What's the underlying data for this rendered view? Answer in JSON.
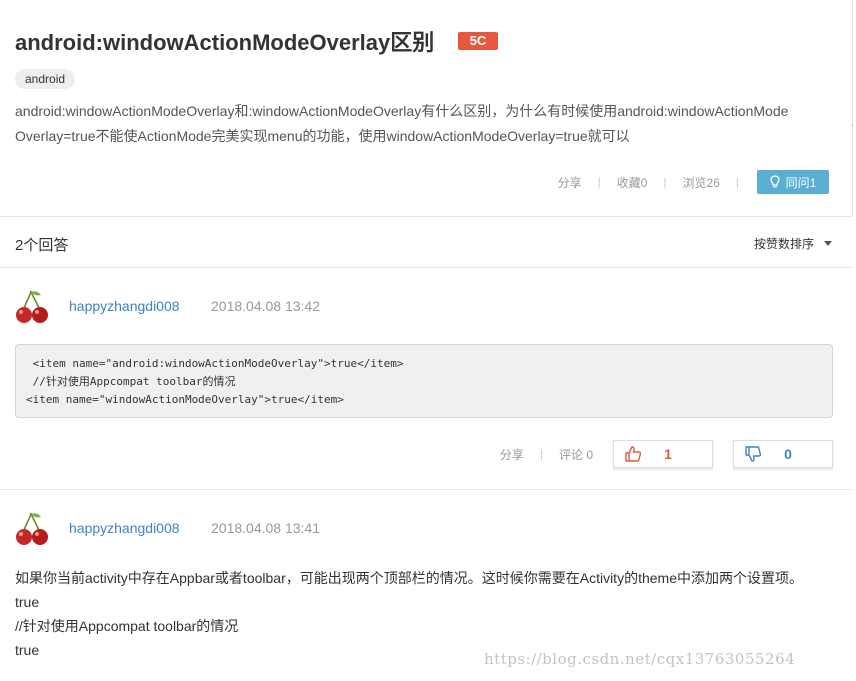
{
  "question": {
    "title": "android:windowActionModeOverlay区别",
    "badge": "5C",
    "tag": "android",
    "description": "android:windowActionModeOverlay和:windowActionModeOverlay有什么区别，为什么有时候使用android:windowActionModeOverlay=true不能使ActionMode完美实现menu的功能，使用windowActionModeOverlay=true就可以",
    "actions": {
      "share": "分享",
      "favorite": "收藏0",
      "views": "浏览26",
      "same_question": "同问1"
    }
  },
  "answers_header": {
    "count": "2个回答",
    "sort": "按赞数排序"
  },
  "answers": [
    {
      "username": "happyzhangdi008",
      "time": "2018.04.08 13:42",
      "code": " <item name=\"android:windowActionModeOverlay\">true</item>\n //针对使用Appcompat toolbar的情况\n<item name=\"windowActionModeOverlay\">true</item>",
      "share": "分享",
      "comments": "评论 0",
      "upvotes": "1",
      "downvotes": "0"
    },
    {
      "username": "happyzhangdi008",
      "time": "2018.04.08 13:41",
      "lines": [
        "如果你当前activity中存在Appbar或者toolbar，可能出现两个顶部栏的情况。这时候你需要在Activity的theme中添加两个设置项。",
        "true",
        "//针对使用Appcompat toolbar的情况",
        "true"
      ]
    }
  ],
  "watermark": "https://blog.csdn.net/cqx13763055264",
  "colors": {
    "accent_blue": "#5aaed1",
    "link_blue": "#3d84c6",
    "badge_red": "#e4593d"
  }
}
